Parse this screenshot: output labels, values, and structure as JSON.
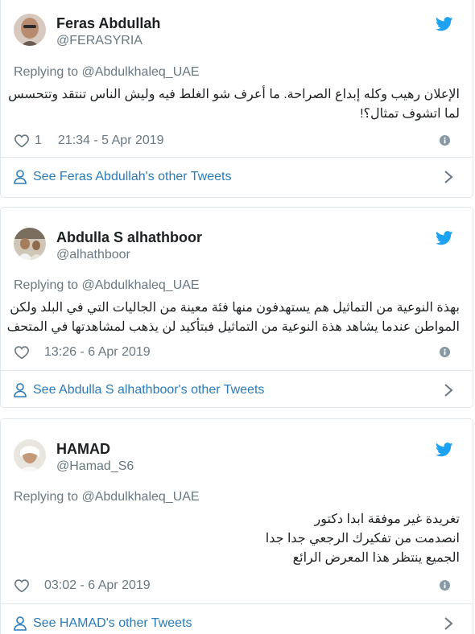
{
  "colors": {
    "twitter_blue": "#1da1f2",
    "link_blue": "#2b7bb9",
    "muted_gray": "#697882",
    "text": "#1c2022",
    "border": "#e1e8ed"
  },
  "tweets": [
    {
      "author": "Feras Abdullah",
      "handle": "@FERASYRIA",
      "replying_to": "Replying to @Abdulkhaleq_UAE",
      "text_lines": [
        "الإعلان رهيب وكله إبداع الصراحة. ما أعرف شو الغلط فيه وليش الناس تنتقد وتتحسس",
        "لما اتشوف تمثال؟!"
      ],
      "likes": "1",
      "timestamp": "21:34 - 5 Apr 2019",
      "see_more": "See Feras Abdullah's other Tweets"
    },
    {
      "author": "Abdulla S alhathboor",
      "handle": "@alhathboor",
      "replying_to": "Replying to @Abdulkhaleq_UAE",
      "text_lines": [
        "بهذة النوعية من التماثيل هم يستهدفون منها فئة معينة من الجاليات التي في البلد ولكن",
        "المواطن عندما يشاهد هذة النوعية من التماثيل فبتأكيد لن يذهب لمشاهدتها في المتحف"
      ],
      "likes": "",
      "timestamp": "13:26 - 6 Apr 2019",
      "see_more": "See Abdulla S alhathboor's other Tweets"
    },
    {
      "author": "HAMAD",
      "handle": "@Hamad_S6",
      "replying_to": "Replying to @Abdulkhaleq_UAE",
      "text_lines": [
        "تغريدة غير موفقة ابدا دكتور",
        "انصدمت من تفكيرك الرجعي جدا جدا",
        "الجميع ينتظر هذا المعرض الرائع"
      ],
      "likes": "",
      "timestamp": "03:02 - 6 Apr 2019",
      "see_more": "See HAMAD's other Tweets"
    }
  ]
}
